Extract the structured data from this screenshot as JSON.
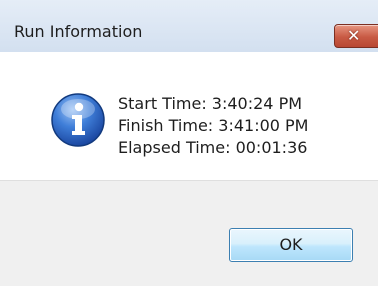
{
  "window": {
    "title": "Run Information",
    "close_glyph": "✕"
  },
  "message": {
    "icon": "info-icon",
    "start_time": "Start Time: 3:40:24 PM",
    "finish_time": "Finish Time: 3:41:00 PM",
    "elapsed_time": "Elapsed Time: 00:01:36"
  },
  "buttons": {
    "ok_label": "OK"
  },
  "colors": {
    "titlebar": "#dce6f4",
    "close_button": "#c85a44",
    "info_icon": "#1f55b5",
    "footer": "#f0f0f0",
    "ok_border": "#3c7fb1"
  }
}
